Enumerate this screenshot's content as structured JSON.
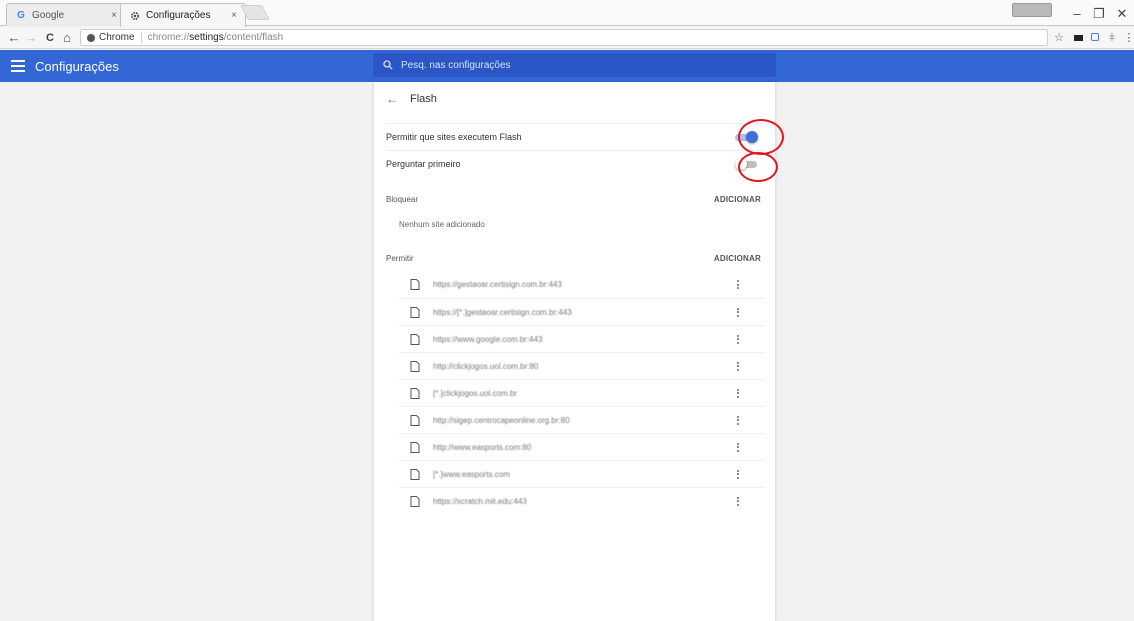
{
  "tabs": [
    {
      "title": "Google",
      "icon": "google-g-icon",
      "close": "×",
      "active": false
    },
    {
      "title": "Configurações",
      "icon": "gear-icon",
      "close": "×",
      "active": true
    }
  ],
  "window_controls": {
    "minimize": "–",
    "restore": "❐",
    "close": "✕"
  },
  "toolbar": {
    "back": "←",
    "forward": "→",
    "reload": "C",
    "home": "⌂",
    "chip_label": "Chrome",
    "url_prefix": "chrome://",
    "url_strong": "settings",
    "url_suffix": "/content/flash",
    "star": "☆"
  },
  "header": {
    "title": "Configurações"
  },
  "search": {
    "placeholder": "Pesq. nas configurações"
  },
  "page": {
    "title": "Flash",
    "back_arrow": "←"
  },
  "settings": [
    {
      "label": "Permitir que sites executem Flash",
      "enabled": true
    },
    {
      "label": "Perguntar primeiro",
      "enabled": false
    }
  ],
  "block_section": {
    "label": "Bloquear",
    "add_label": "ADICIONAR",
    "empty_text": "Nenhum site adicionado"
  },
  "allow_section": {
    "label": "Permitir",
    "add_label": "ADICIONAR",
    "sites": [
      "https://gestaoar.certisign.com.br:443",
      "https://[*.]gestaoar.certisign.com.br:443",
      "https://www.google.com.br:443",
      "http://clickjogos.uol.com.br:80",
      "[*.]clickjogos.uol.com.br",
      "http://sigep.centrocapeonline.org.br:80",
      "http://www.easports.com:80",
      "[*.]www.easports.com",
      "https://scratch.mit.edu:443"
    ]
  },
  "colors": {
    "header_blue": "#3367d6",
    "toggle_on": "#3f6fd6",
    "annotation_red": "#e0171f"
  }
}
